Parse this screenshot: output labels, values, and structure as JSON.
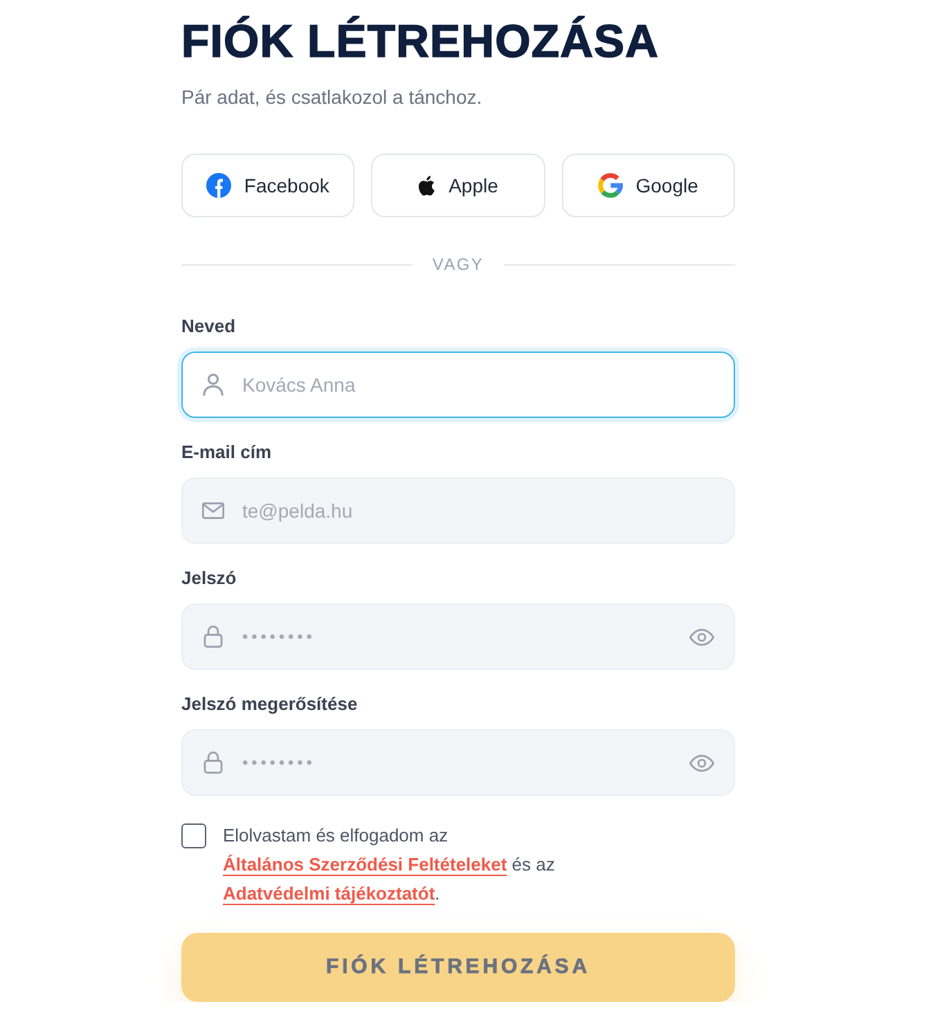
{
  "header": {
    "title": "FIÓK LÉTREHOZÁSA",
    "subtitle": "Pár adat, és csatlakozol a tánchoz."
  },
  "social_buttons": [
    {
      "kind": "facebook",
      "label": "Facebook"
    },
    {
      "kind": "apple",
      "label": "Apple"
    },
    {
      "kind": "google",
      "label": "Google"
    }
  ],
  "divider": {
    "label": "VAGY"
  },
  "fields": [
    {
      "kind": "name",
      "label": "Neved",
      "placeholder": "Kovács Anna",
      "focused": true
    },
    {
      "kind": "email",
      "label": "E-mail cím",
      "placeholder": "te@pelda.hu",
      "focused": false
    },
    {
      "kind": "password",
      "label": "Jelszó",
      "placeholder": "••••••••",
      "focused": false
    },
    {
      "kind": "password",
      "label": "Jelszó megerősítése",
      "placeholder": "••••••••",
      "focused": false
    }
  ],
  "terms": {
    "checked": false,
    "parts": [
      {
        "kind": "text",
        "text": "Elolvastam és elfogadom az "
      },
      {
        "kind": "link",
        "text": "Általános Szerződési Feltételeket"
      },
      {
        "kind": "text",
        "text": " és az "
      },
      {
        "kind": "link",
        "text": "Adatvédelmi tájékoztatót"
      },
      {
        "kind": "text",
        "text": "."
      }
    ]
  },
  "submit": {
    "label": "FIÓK LÉTREHOZÁSA",
    "disabled": true
  }
}
